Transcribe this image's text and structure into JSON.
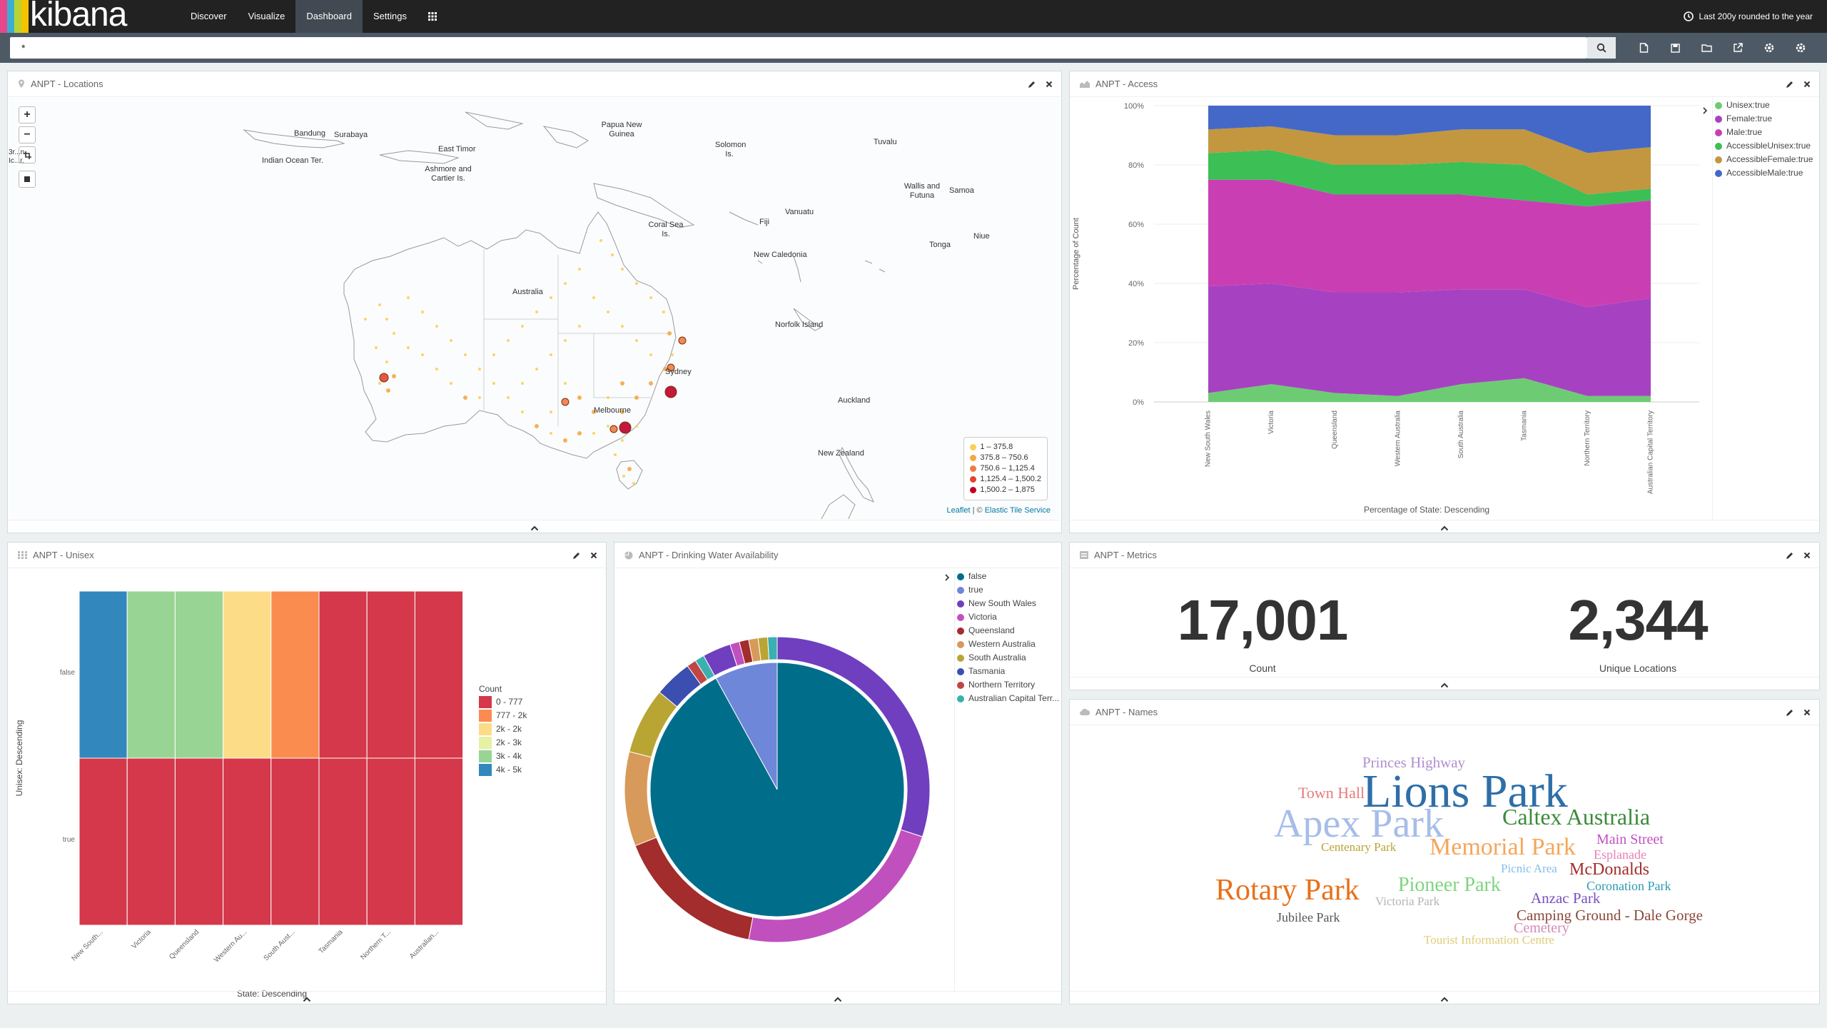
{
  "nav": {
    "brand": "kibana",
    "stripe_colors": [
      "#e8488b",
      "#3caed2",
      "#b9d432",
      "#f4c300"
    ],
    "tabs": [
      {
        "label": "Discover"
      },
      {
        "label": "Visualize"
      },
      {
        "label": "Dashboard",
        "active": true
      },
      {
        "label": "Settings"
      }
    ],
    "more_icon": "grid-icon",
    "time_label": "Last 200y rounded to the year"
  },
  "search": {
    "value": "*",
    "icons": [
      "search-icon",
      "new-dashboard-icon",
      "save-icon",
      "open-icon",
      "share-icon",
      "options-icon",
      "settings-icon"
    ]
  },
  "panels": {
    "locations": {
      "title": "ANPT - Locations",
      "map_labels": [
        "Bandung",
        "Surabaya",
        "Indian Ocean Ter.",
        "East Timor",
        "Ashmore and Cartier Is.",
        "Papua New Guinea",
        "Solomon Is.",
        "Tuvalu",
        "Wallis and Futuna",
        "Samoa",
        "Fiji",
        "Vanuatu",
        "Coral Sea Is.",
        "New Caledonia",
        "Tonga",
        "Niue",
        "Australia",
        "Norfolk Island",
        "Sydney",
        "Melbourne",
        "Auckland",
        "New Zealand"
      ],
      "edge_labels": [
        "3r...n",
        "Ic...r."
      ],
      "legend": [
        {
          "label": "1 – 375.8",
          "color": "#f7d05a"
        },
        {
          "label": "375.8 – 750.6",
          "color": "#f5a942"
        },
        {
          "label": "750.6 – 1,125.4",
          "color": "#f07b3f"
        },
        {
          "label": "1,125.4 – 1,500.2",
          "color": "#e0452f"
        },
        {
          "label": "1,500.2 – 1,875",
          "color": "#bd0026"
        }
      ],
      "attribution_prefix": "Leaflet",
      "attribution_suffix": "| © ",
      "attribution_link": "Elastic Tile Service"
    },
    "access": {
      "title": "ANPT - Access",
      "ylabel": "Percentage of Count",
      "xlabel": "Percentage of State: Descending",
      "legend": [
        {
          "label": "Unisex:true",
          "color": "#6dcc73"
        },
        {
          "label": "Female:true",
          "color": "#a642c1"
        },
        {
          "label": "Male:true",
          "color": "#c93fb3"
        },
        {
          "label": "AccessibleUnisex:true",
          "color": "#3cbf55"
        },
        {
          "label": "AccessibleFemale:true",
          "color": "#c2973f"
        },
        {
          "label": "AccessibleMale:true",
          "color": "#4468c8"
        }
      ]
    },
    "unisex": {
      "title": "ANPT - Unisex",
      "ylabel": "Unisex: Descending",
      "xlabel": "State: Descending",
      "legend_title": "Count",
      "legend": [
        {
          "label": "0 - 777",
          "color": "#d4384a"
        },
        {
          "label": "777 - 2k",
          "color": "#fa8c50"
        },
        {
          "label": "2k - 2k",
          "color": "#fddc87"
        },
        {
          "label": "2k - 3k",
          "color": "#e5f1a3"
        },
        {
          "label": "3k - 4k",
          "color": "#98d594"
        },
        {
          "label": "4k - 5k",
          "color": "#3288bd"
        }
      ]
    },
    "water": {
      "title": "ANPT - Drinking Water Availability",
      "legend": [
        {
          "label": "false",
          "color": "#006e8a"
        },
        {
          "label": "true",
          "color": "#6f87d8"
        },
        {
          "label": "New South Wales",
          "color": "#6f3fbf"
        },
        {
          "label": "Victoria",
          "color": "#c150bf"
        },
        {
          "label": "Queensland",
          "color": "#a32c2c"
        },
        {
          "label": "Western Australia",
          "color": "#d89a5a"
        },
        {
          "label": "South Australia",
          "color": "#b8a534"
        },
        {
          "label": "Tasmania",
          "color": "#3a4fb0"
        },
        {
          "label": "Northern Territory",
          "color": "#c14545"
        },
        {
          "label": "Australian Capital Terr...",
          "color": "#3ab0b0"
        }
      ]
    },
    "metrics": {
      "title": "ANPT - Metrics",
      "items": [
        {
          "value": "17,001",
          "label": "Count"
        },
        {
          "value": "2,344",
          "label": "Unique Locations"
        }
      ]
    },
    "names": {
      "title": "ANPT - Names",
      "words": [
        {
          "text": "Princes Highway",
          "color": "#b08ed0"
        },
        {
          "text": "Lions Park",
          "color": "#2e6fa8"
        },
        {
          "text": "Town Hall",
          "color": "#e87b7b"
        },
        {
          "text": "Caltex Australia",
          "color": "#3a8a3a"
        },
        {
          "text": "Apex Park",
          "color": "#a6bde8"
        },
        {
          "text": "Main Street",
          "color": "#c04fc4"
        },
        {
          "text": "Centenary Park",
          "color": "#b8a534"
        },
        {
          "text": "Memorial Park",
          "color": "#f5a65a"
        },
        {
          "text": "Esplanade",
          "color": "#e87fb6"
        },
        {
          "text": "Picnic Area",
          "color": "#7fbfe8"
        },
        {
          "text": "McDonalds",
          "color": "#a32c2c"
        },
        {
          "text": "Rotary Park",
          "color": "#e8701a"
        },
        {
          "text": "Pioneer Park",
          "color": "#7fd47f"
        },
        {
          "text": "Coronation Park",
          "color": "#2f9ab0"
        },
        {
          "text": "Victoria Park",
          "color": "#b5b5b5"
        },
        {
          "text": "Anzac Park",
          "color": "#7a4fbf"
        },
        {
          "text": "Jubilee Park",
          "color": "#555555"
        },
        {
          "text": "Camping Ground - Dale Gorge",
          "color": "#8a4a3a"
        },
        {
          "text": "Cemetery",
          "color": "#d48ab8"
        },
        {
          "text": "Tourist Information Centre",
          "color": "#e0cd7a"
        }
      ]
    }
  },
  "chart_data": [
    {
      "type": "area",
      "title": "ANPT - Access",
      "ylabel": "Percentage of Count",
      "xlabel": "Percentage of State: Descending",
      "categories": [
        "New South Wales",
        "Victoria",
        "Queensland",
        "Western Australia",
        "South Australia",
        "Tasmania",
        "Northern Territory",
        "Australian Capital Territory"
      ],
      "yticks": [
        "0%",
        "20%",
        "40%",
        "60%",
        "80%",
        "100%"
      ],
      "ylim": [
        0,
        100
      ],
      "series": [
        {
          "name": "Unisex:true",
          "color": "#6dcc73",
          "values": [
            3,
            6,
            3,
            2,
            6,
            8,
            2,
            2
          ]
        },
        {
          "name": "Female:true",
          "color": "#a642c1",
          "values": [
            36,
            34,
            34,
            35,
            32,
            30,
            30,
            33
          ]
        },
        {
          "name": "Male:true",
          "color": "#c93fb3",
          "values": [
            36,
            35,
            33,
            33,
            32,
            30,
            34,
            33
          ]
        },
        {
          "name": "AccessibleUnisex:true",
          "color": "#3cbf55",
          "values": [
            9,
            10,
            10,
            10,
            11,
            12,
            4,
            4
          ]
        },
        {
          "name": "AccessibleFemale:true",
          "color": "#c2973f",
          "values": [
            8,
            8,
            10,
            10,
            11,
            12,
            14,
            14
          ]
        },
        {
          "name": "AccessibleMale:true",
          "color": "#4468c8",
          "values": [
            8,
            7,
            10,
            10,
            8,
            8,
            16,
            14
          ]
        }
      ],
      "legend_position": "right"
    },
    {
      "type": "heatmap",
      "title": "ANPT - Unisex",
      "xlabel": "State: Descending",
      "ylabel": "Unisex: Descending",
      "x_categories": [
        "New South...",
        "Victoria",
        "Queensland",
        "Western Au...",
        "South Aust...",
        "Tasmania",
        "Northern T...",
        "Australian..."
      ],
      "y_categories": [
        "false",
        "true"
      ],
      "cell_colors": [
        [
          "#3288bd",
          "#98d594",
          "#98d594",
          "#fddc87",
          "#fa8c50",
          "#d4384a",
          "#d4384a",
          "#d4384a"
        ],
        [
          "#d4384a",
          "#d4384a",
          "#d4384a",
          "#d4384a",
          "#d4384a",
          "#d4384a",
          "#d4384a",
          "#d4384a"
        ]
      ],
      "legend_title": "Count",
      "legend_position": "right"
    },
    {
      "type": "pie",
      "title": "ANPT - Drinking Water Availability",
      "inner": [
        {
          "label": "false",
          "value": 92,
          "color": "#006e8a"
        },
        {
          "label": "true",
          "value": 8,
          "color": "#6f87d8"
        }
      ],
      "outer": [
        {
          "label": "New South Wales",
          "value": 30,
          "color": "#6f3fbf"
        },
        {
          "label": "Victoria",
          "value": 23,
          "color": "#c150bf"
        },
        {
          "label": "Queensland",
          "value": 16,
          "color": "#a32c2c"
        },
        {
          "label": "Western Australia",
          "value": 10,
          "color": "#d89a5a"
        },
        {
          "label": "South Australia",
          "value": 7,
          "color": "#b8a534"
        },
        {
          "label": "Tasmania",
          "value": 4,
          "color": "#3a4fb0"
        },
        {
          "label": "Northern Territory",
          "value": 1,
          "color": "#c14545"
        },
        {
          "label": "Australian Capital Territory",
          "value": 1,
          "color": "#3ab0b0"
        },
        {
          "label": "",
          "value": 3,
          "color": "#6f3fbf"
        },
        {
          "label": "",
          "value": 1,
          "color": "#c150bf"
        },
        {
          "label": "",
          "value": 1,
          "color": "#a32c2c"
        },
        {
          "label": "",
          "value": 1,
          "color": "#d89a5a"
        },
        {
          "label": "",
          "value": 1,
          "color": "#b8a534"
        },
        {
          "label": "",
          "value": 1,
          "color": "#3ab0b0"
        }
      ],
      "legend_position": "right"
    }
  ]
}
